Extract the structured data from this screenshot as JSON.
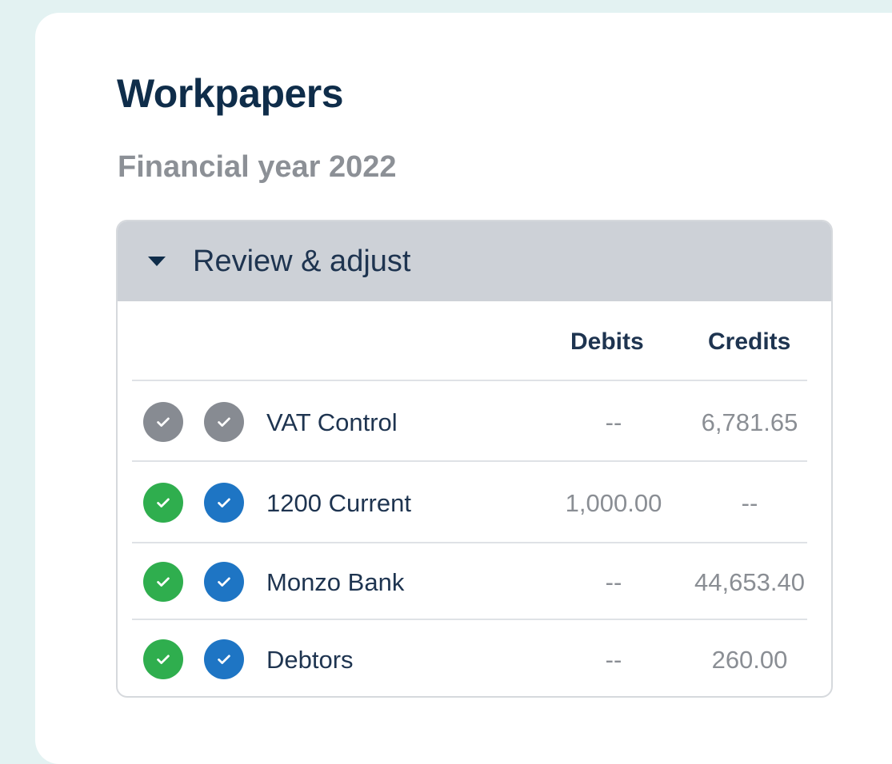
{
  "page": {
    "title": "Workpapers",
    "subtitle": "Financial year 2022"
  },
  "panel": {
    "title": "Review & adjust",
    "expanded": true,
    "columns": {
      "debits": "Debits",
      "credits": "Credits"
    }
  },
  "rows": [
    {
      "name": "VAT Control",
      "debit": "--",
      "credit": "6,781.65",
      "status1": "grey",
      "status2": "grey"
    },
    {
      "name": "1200 Current",
      "debit": "1,000.00",
      "credit": "--",
      "status1": "green",
      "status2": "blue"
    },
    {
      "name": "Monzo Bank",
      "debit": "--",
      "credit": "44,653.40",
      "status1": "green",
      "status2": "blue"
    },
    {
      "name": "Debtors",
      "debit": "--",
      "credit": "260.00",
      "status1": "green",
      "status2": "blue"
    }
  ],
  "colors": {
    "grey": "#878b92",
    "green": "#2fae4e",
    "blue": "#1e75c4",
    "heading": "#0f2d4a"
  },
  "icons": {
    "caret": "caret-down-icon",
    "check": "check-icon"
  }
}
